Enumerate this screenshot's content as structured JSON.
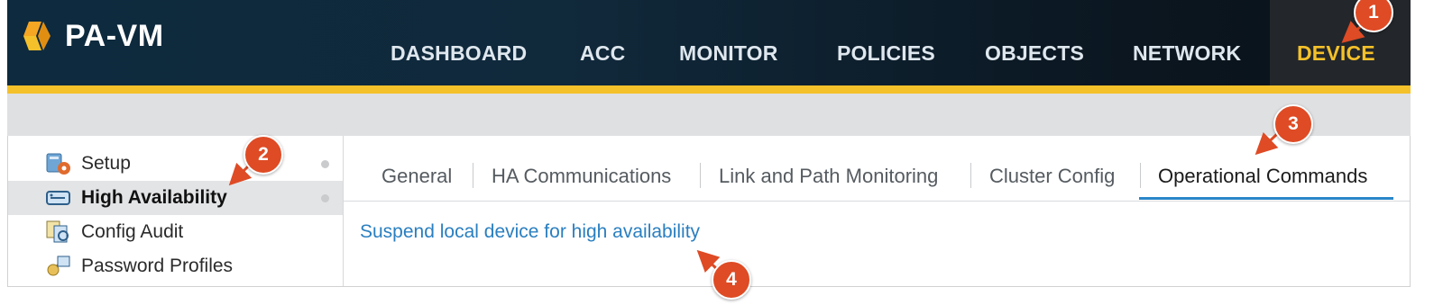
{
  "app": {
    "logo_text": "PA-VM"
  },
  "nav": {
    "items": [
      {
        "label": "DASHBOARD"
      },
      {
        "label": "ACC"
      },
      {
        "label": "MONITOR"
      },
      {
        "label": "POLICIES"
      },
      {
        "label": "OBJECTS"
      },
      {
        "label": "NETWORK"
      },
      {
        "label": "DEVICE"
      }
    ],
    "active": "DEVICE"
  },
  "sidebar": {
    "items": [
      {
        "label": "Setup",
        "icon": "setup-icon"
      },
      {
        "label": "High Availability",
        "icon": "high-availability-icon",
        "selected": true
      },
      {
        "label": "Config Audit",
        "icon": "config-audit-icon"
      },
      {
        "label": "Password Profiles",
        "icon": "password-profiles-icon"
      }
    ]
  },
  "tabs": {
    "items": [
      {
        "label": "General"
      },
      {
        "label": "HA Communications"
      },
      {
        "label": "Link and Path Monitoring"
      },
      {
        "label": "Cluster Config"
      },
      {
        "label": "Operational Commands"
      }
    ],
    "active": "Operational Commands"
  },
  "content": {
    "link_label": "Suspend local device for high availability"
  },
  "callouts": [
    "1",
    "2",
    "3",
    "4"
  ],
  "colors": {
    "header_bg": "#0e2a3e",
    "accent_yellow": "#f5c12a",
    "link_blue": "#2a7fc0",
    "tab_underline": "#2a86c9",
    "callout_red": "#de4b25"
  }
}
